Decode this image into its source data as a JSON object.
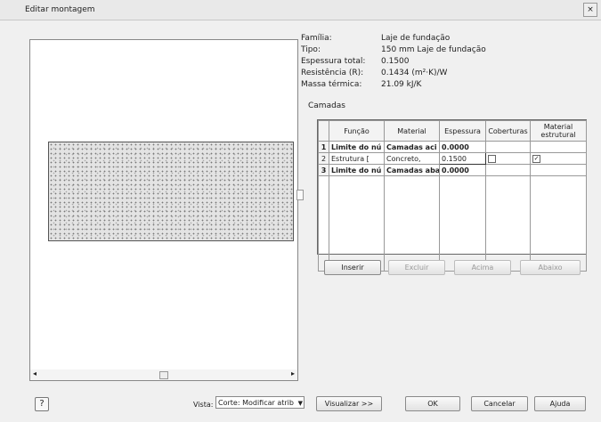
{
  "window": {
    "title": "Editar montagem",
    "close_glyph": "×"
  },
  "properties": [
    {
      "key": "Família:",
      "value": "Laje de fundação"
    },
    {
      "key": "Tipo:",
      "value": "150 mm Laje de fundação"
    },
    {
      "key": "Espessura total:",
      "value": "0.1500"
    },
    {
      "key": "Resistência (R):",
      "value": "0.1434 (m²·K)/W"
    },
    {
      "key": "Massa térmica:",
      "value": "21.09 kJ/K"
    }
  ],
  "camadas_label": "Camadas",
  "table": {
    "headers": [
      "",
      "Função",
      "Material",
      "Espessura",
      "Coberturas",
      "Material estrutural"
    ],
    "rows": [
      {
        "num": "1",
        "funcao": "Limite do nú",
        "material": "Camadas aci",
        "espessura": "0.0000",
        "coberturas": "",
        "estrutural": ""
      },
      {
        "num": "2",
        "funcao": "Estrutura [",
        "material": "Concreto,",
        "espessura": "0.1500",
        "coberturas": "",
        "estrutural": "✓"
      },
      {
        "num": "3",
        "funcao": "Limite do nú",
        "material": "Camadas abai",
        "espessura": "0.0000",
        "coberturas": "",
        "estrutural": ""
      }
    ]
  },
  "layer_buttons": {
    "insert": "Inserir",
    "delete": "Excluir",
    "up": "Acima",
    "down": "Abaixo"
  },
  "bottom": {
    "view_label": "Vista:",
    "view_value": "Corte: Modificar atrib",
    "preview": "Visualizar >>",
    "ok": "OK",
    "cancel": "Cancelar",
    "help": "Ajuda"
  },
  "icons": {
    "help": "help-icon",
    "left_arrow": "◂",
    "right_arrow": "▸",
    "dropdown": "▼"
  }
}
